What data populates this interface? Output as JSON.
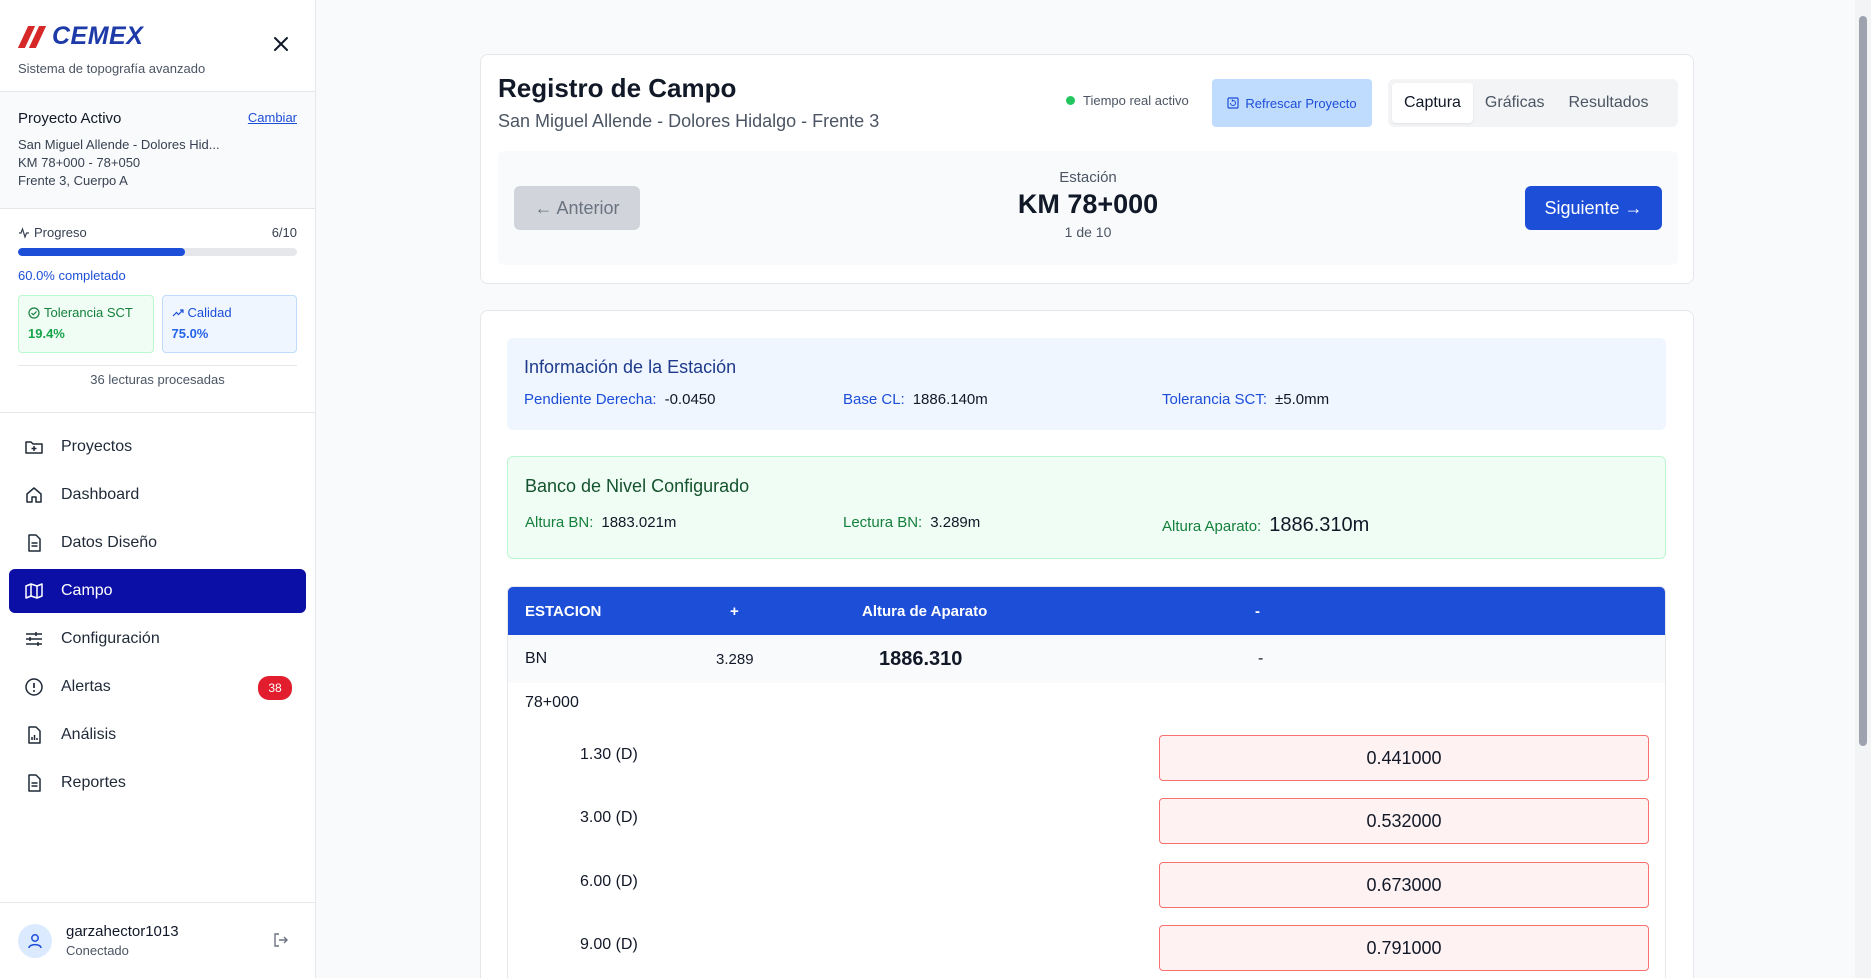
{
  "brand": {
    "logo_text": "CEMEX",
    "subtitle": "Sistema de topografía avanzado"
  },
  "project": {
    "heading": "Proyecto Activo",
    "change_label": "Cambiar",
    "name": "San Miguel Allende - Dolores Hid...",
    "km_range": "KM 78+000 - 78+050",
    "location": "Frente 3, Cuerpo A"
  },
  "progress": {
    "label": "Progreso",
    "count": "6/10",
    "fraction": 0.6,
    "completed_text": "60.0% completado",
    "tolerance_label": "Tolerancia SCT",
    "tolerance_value": "19.4%",
    "quality_label": "Calidad",
    "quality_value": "75.0%",
    "readings_text": "36 lecturas procesadas"
  },
  "nav": {
    "items": [
      {
        "label": "Proyectos",
        "icon": "folder-plus-icon"
      },
      {
        "label": "Dashboard",
        "icon": "home-icon"
      },
      {
        "label": "Datos Diseño",
        "icon": "file-text-icon"
      },
      {
        "label": "Campo",
        "icon": "map-icon",
        "active": true
      },
      {
        "label": "Configuración",
        "icon": "sliders-icon"
      },
      {
        "label": "Alertas",
        "icon": "alert-circle-icon",
        "badge": "38"
      },
      {
        "label": "Análisis",
        "icon": "file-chart-icon"
      },
      {
        "label": "Reportes",
        "icon": "file-text-icon"
      }
    ]
  },
  "user": {
    "name": "garzahector1013",
    "status": "Conectado"
  },
  "header": {
    "title": "Registro de Campo",
    "subtitle": "San Miguel Allende - Dolores Hidalgo - Frente 3",
    "realtime_label": "Tiempo real activo",
    "refresh_label": "Refrescar Proyecto",
    "tabs": [
      {
        "label": "Captura",
        "active": true
      },
      {
        "label": "Gráficas"
      },
      {
        "label": "Resultados"
      }
    ]
  },
  "station": {
    "label": "Estación",
    "km": "KM 78+000",
    "position": "1 de 10",
    "prev_label": "← Anterior",
    "next_label": "Siguiente →"
  },
  "station_info": {
    "title": "Información de la Estación",
    "slope_label": "Pendiente Derecha:",
    "slope_value": "-0.0450",
    "base_label": "Base CL:",
    "base_value": "1886.140m",
    "tolerance_label": "Tolerancia SCT:",
    "tolerance_value": "±5.0mm"
  },
  "bench": {
    "title": "Banco de Nivel Configurado",
    "height_label": "Altura BN:",
    "height_value": "1883.021m",
    "reading_label": "Lectura BN:",
    "reading_value": "3.289m",
    "instrument_label": "Altura Aparato:",
    "instrument_value": "1886.310m"
  },
  "table": {
    "headers": [
      "ESTACION",
      "+",
      "Altura de Aparato",
      "-"
    ],
    "bn_row": {
      "station": "BN",
      "plus": "3.289",
      "instrument": "1886.310",
      "minus": "-"
    },
    "station_row": "78+000",
    "readings": [
      {
        "label": "1.30 (D)",
        "value": "0.441000"
      },
      {
        "label": "3.00 (D)",
        "value": "0.532000"
      },
      {
        "label": "6.00 (D)",
        "value": "0.673000"
      },
      {
        "label": "9.00 (D)",
        "value": "0.791000"
      }
    ]
  },
  "colors": {
    "primary": "#1d4ed8",
    "active_nav": "#0b0fa6",
    "badge": "#e11d2e",
    "success": "#16a34a",
    "error_border": "#f87171"
  }
}
